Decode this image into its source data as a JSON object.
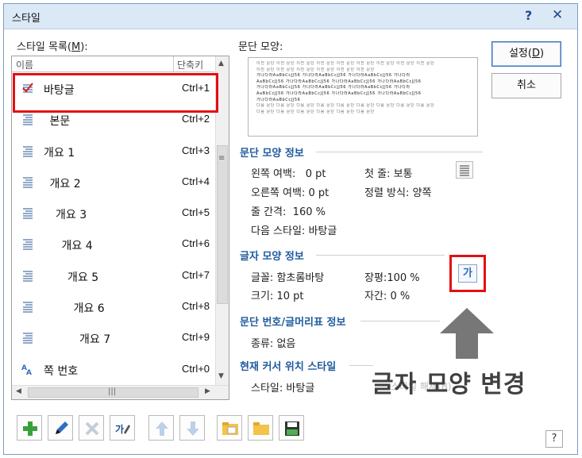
{
  "window": {
    "title": "스타일",
    "help_glyph": "?",
    "close_glyph": "✕"
  },
  "style_list": {
    "label_prefix": "스타일 목록(",
    "label_mnemonic": "M",
    "label_suffix": "):",
    "col_name": "이름",
    "col_shortcut": "단축키",
    "items": [
      {
        "name": "바탕글",
        "shortcut": "Ctrl+1",
        "indent": 0,
        "icon": "default-style-icon"
      },
      {
        "name": "본문",
        "shortcut": "Ctrl+2",
        "indent": 1,
        "icon": "paragraph-style-icon"
      },
      {
        "name": "개요 1",
        "shortcut": "Ctrl+3",
        "indent": 0,
        "icon": "paragraph-style-icon"
      },
      {
        "name": "개요 2",
        "shortcut": "Ctrl+4",
        "indent": 1,
        "icon": "paragraph-style-icon"
      },
      {
        "name": "개요 3",
        "shortcut": "Ctrl+5",
        "indent": 2,
        "icon": "paragraph-style-icon"
      },
      {
        "name": "개요 4",
        "shortcut": "Ctrl+6",
        "indent": 3,
        "icon": "paragraph-style-icon"
      },
      {
        "name": "개요 5",
        "shortcut": "Ctrl+7",
        "indent": 4,
        "icon": "paragraph-style-icon"
      },
      {
        "name": "개요 6",
        "shortcut": "Ctrl+8",
        "indent": 5,
        "icon": "paragraph-style-icon"
      },
      {
        "name": "개요 7",
        "shortcut": "Ctrl+9",
        "indent": 6,
        "icon": "paragraph-style-icon"
      },
      {
        "name": "쪽 번호",
        "shortcut": "Ctrl+0",
        "indent": 0,
        "icon": "character-style-icon"
      }
    ]
  },
  "preview": {
    "label": "문단 모양:",
    "lines_light": [
      "이전 문단 이전 문단 이전 문단 이전 문단 이전 문단 이전 문단 이전 문단 이전 문단 이전 문단",
      "이전 문단 이전 문단 이전 문단 이전 문단 이전 문단 이전 문단"
    ],
    "lines_dark": [
      "가나다라AaBbCcJJ56 가나다라AaBbCcJJ56 가나다라AaBbCcJJ56 가나다라",
      "AaBbCcJJ56 가나다라AaBbCcJJ56 가나다라AaBbCcJJ56 가나다라AaBbCcJJ56",
      "가나다라AaBbCcJJ56 가나다라AaBbCcJJ56 가나다라AaBbCcJJ56 가나다라",
      "AaBbCcJJ56 가나다라AaBbCcJJ56 가나다라AaBbCcJJ56 가나다라AaBbCcJJ56",
      "가나다라AaBbCcJJ56"
    ],
    "lines_after": [
      "다음 문단 다음 문단 다음 문단 다음 문단 다음 문단 다음 문단 다음 문단 다음 문단 다음 문단",
      "다음 문단 다음 문단 다음 문단 다음 문단 다음 문단 다음 문단"
    ]
  },
  "paragraph_info": {
    "title": "문단 모양 정보",
    "left_margin_label": "왼쪽 여백:",
    "left_margin_value": "0 pt",
    "first_line_label": "첫 줄:",
    "first_line_value": "보통",
    "right_margin_label": "오른쪽 여백:",
    "right_margin_value": "0 pt",
    "align_label": "정렬 방식:",
    "align_value": "양쪽",
    "line_spacing_label": "줄 간격:",
    "line_spacing_value": "160 %",
    "next_style_label": "다음 스타일:",
    "next_style_value": "바탕글"
  },
  "char_info": {
    "title": "글자 모양 정보",
    "font_label": "글꼴:",
    "font_value": "함초롬바탕",
    "width_label": "장평:",
    "width_value": "100 %",
    "size_label": "크기:",
    "size_value": "10 pt",
    "spacing_label": "자간:",
    "spacing_value": "0 %",
    "char_button_glyph": "가"
  },
  "numbering_info": {
    "title": "문단 번호/글머리표 정보",
    "kind_label": "종류:",
    "kind_value": "없음"
  },
  "cursor_style": {
    "title": "현재 커서 위치 스타일",
    "style_label": "스타일:",
    "style_value": "바탕글",
    "button_hint": "스타일 해제(B)"
  },
  "buttons": {
    "set_prefix": "설정(",
    "set_mnemonic": "D",
    "set_suffix": ")",
    "cancel": "취소",
    "help": "?"
  },
  "annotation": {
    "text": "글자 모양 변경"
  },
  "colors": {
    "highlight": "#e30f12",
    "section_title": "#1f5b9e",
    "add": "#3aa13a",
    "delete": "#c9d3dc"
  }
}
